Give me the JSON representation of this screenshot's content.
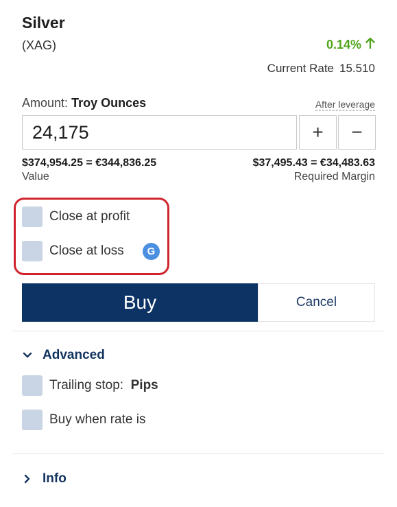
{
  "instrument": {
    "name": "Silver",
    "symbol": "(XAG)",
    "change": "0.14%",
    "change_icon": "arrow-up-icon",
    "current_rate_label": "Current Rate",
    "current_rate_value": "15.510"
  },
  "amount": {
    "label": "Amount:",
    "unit": "Troy Ounces",
    "after_leverage": "After leverage",
    "value": "24,175",
    "plus": "+",
    "minus": "−"
  },
  "totals": {
    "value_amount": "$374,954.25 = €344,836.25",
    "value_label": "Value",
    "margin_amount": "$37,495.43 = €34,483.63",
    "margin_label": "Required Margin"
  },
  "close_options": {
    "profit_label": "Close at profit",
    "loss_label": "Close at loss",
    "badge": "G"
  },
  "actions": {
    "buy": "Buy",
    "cancel": "Cancel"
  },
  "advanced": {
    "title": "Advanced",
    "trailing_stop_label": "Trailing stop:",
    "trailing_stop_unit": "Pips",
    "buy_when_label": "Buy when rate is"
  },
  "info": {
    "title": "Info"
  },
  "colors": {
    "brand": "#0d3365",
    "positive": "#52a51e",
    "highlight": "#d0232e",
    "checkbox": "#c9d5e4"
  }
}
